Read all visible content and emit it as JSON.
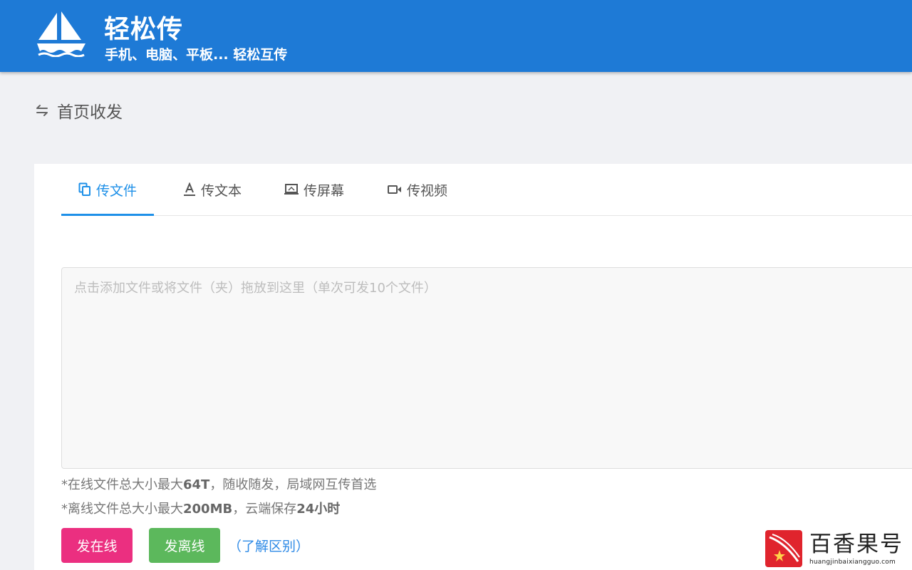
{
  "app": {
    "title": "轻松传",
    "subtitle": "手机、电脑、平板... 轻松互传"
  },
  "breadcrumb": {
    "icon": "swap-icon",
    "label": "首页收发"
  },
  "tabs": [
    {
      "label": "传文件",
      "icon": "file-copy-icon",
      "active": true
    },
    {
      "label": "传文本",
      "icon": "text-icon",
      "active": false
    },
    {
      "label": "传屏幕",
      "icon": "screen-icon",
      "active": false
    },
    {
      "label": "传视频",
      "icon": "video-camera-icon",
      "active": false
    }
  ],
  "dropzone": {
    "placeholder": "点击添加文件或将文件（夹）拖放到这里（单次可发10个文件）"
  },
  "notes": {
    "online_prefix": "*在线文件总大小最大",
    "online_size": "64T",
    "online_suffix": "，随收随发，局域网互传首选",
    "offline_prefix": "*离线文件总大小最大",
    "offline_size": "200MB",
    "offline_mid": "，云端保存",
    "offline_duration": "24小时"
  },
  "actions": {
    "send_online": "发在线",
    "send_offline": "发离线",
    "learn_difference": "（了解区别）"
  },
  "watermark": {
    "name": "百香果号",
    "url": "huangjinbaixiangguo.com"
  },
  "colors": {
    "header": "#1e7ad6",
    "tab_active": "#1e90e8",
    "send_online": "#eb2f80",
    "send_offline": "#5cb85c",
    "link": "#2e8ae6"
  }
}
